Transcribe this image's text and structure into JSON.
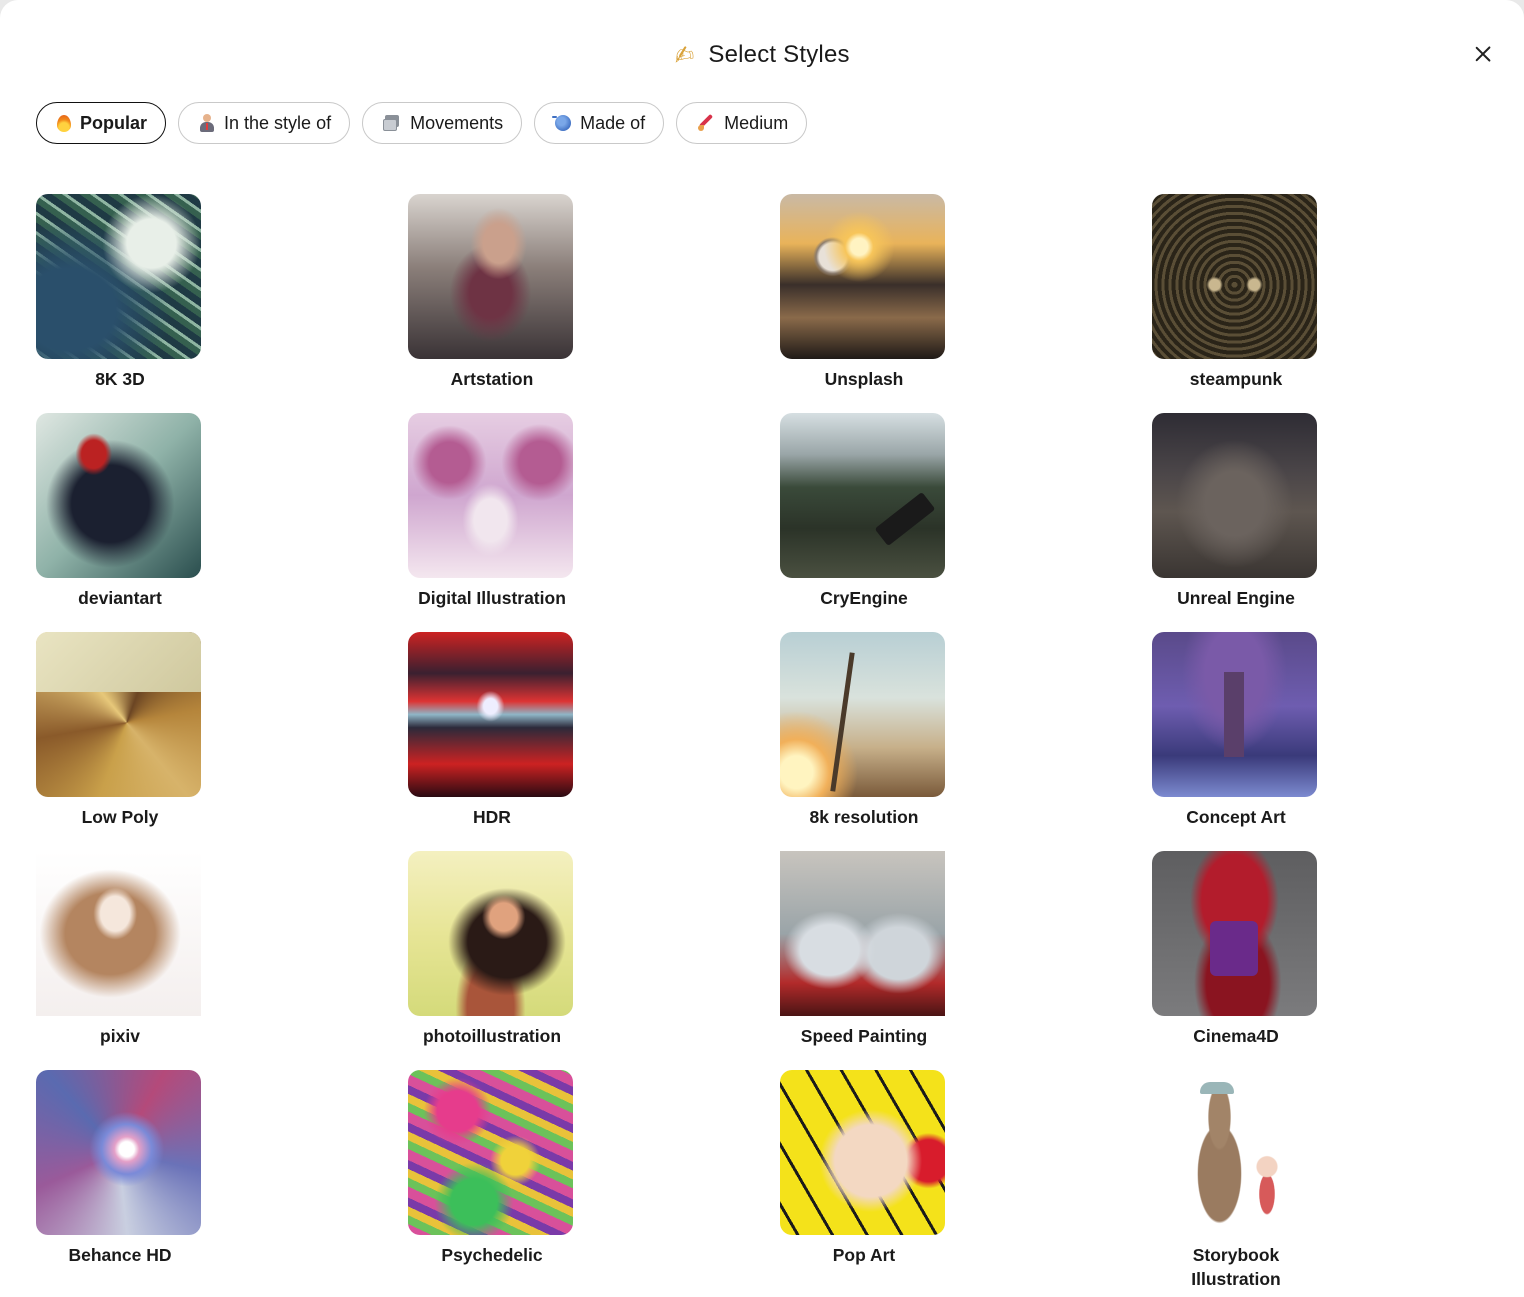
{
  "dialog": {
    "title": "Select Styles",
    "title_icon": "writing-hand-icon",
    "close_icon": "close-icon"
  },
  "tabs": [
    {
      "label": "Popular",
      "icon": "flame-icon",
      "active": true
    },
    {
      "label": "In the style of",
      "icon": "artist-icon",
      "active": false
    },
    {
      "label": "Movements",
      "icon": "card-stack-icon",
      "active": false
    },
    {
      "label": "Made of",
      "icon": "yarn-icon",
      "active": false
    },
    {
      "label": "Medium",
      "icon": "paintbrush-icon",
      "active": false
    }
  ],
  "styles": [
    {
      "label": "8K 3D"
    },
    {
      "label": "Artstation"
    },
    {
      "label": "Unsplash"
    },
    {
      "label": "steampunk"
    },
    {
      "label": "deviantart"
    },
    {
      "label": "Digital Illustration"
    },
    {
      "label": "CryEngine"
    },
    {
      "label": "Unreal Engine"
    },
    {
      "label": "Low Poly"
    },
    {
      "label": "HDR"
    },
    {
      "label": "8k resolution"
    },
    {
      "label": "Concept Art"
    },
    {
      "label": "pixiv"
    },
    {
      "label": "photoillustration"
    },
    {
      "label": "Speed Painting"
    },
    {
      "label": "Cinema4D"
    },
    {
      "label": "Behance HD"
    },
    {
      "label": "Psychedelic"
    },
    {
      "label": "Pop Art"
    },
    {
      "label": "Storybook Illustration"
    }
  ]
}
